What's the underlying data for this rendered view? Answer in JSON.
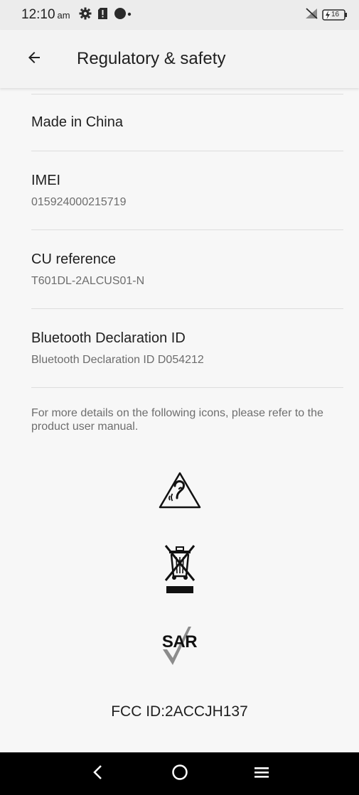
{
  "status_bar": {
    "time": "12:10",
    "ampm": "am",
    "battery_level": "16",
    "icons": [
      "gear-icon",
      "sd-card-alert-icon",
      "notification-dot-icon",
      "no-sim-icon",
      "battery-charging-icon"
    ]
  },
  "app_bar": {
    "title": "Regulatory & safety",
    "back_icon": "arrow-back-icon"
  },
  "items": [
    {
      "title": "Made in China",
      "subtitle": ""
    },
    {
      "title": "IMEI",
      "subtitle": "015924000215719"
    },
    {
      "title": "CU reference",
      "subtitle": "T601DL-2ALCUS01-N"
    },
    {
      "title": "Bluetooth Declaration ID",
      "subtitle": "Bluetooth Declaration ID D054212"
    }
  ],
  "note": "For more details on the following icons, please refer to the product user manual.",
  "regulatory_icons": [
    "hearing-aid-compatibility-icon",
    "weee-crossed-bin-icon",
    "sar-icon"
  ],
  "sar_label": "SAR",
  "fcc_id": "FCC ID:2ACCJH137",
  "nav_bar": {
    "icons": [
      "back-icon",
      "home-icon",
      "recents-menu-icon"
    ]
  }
}
